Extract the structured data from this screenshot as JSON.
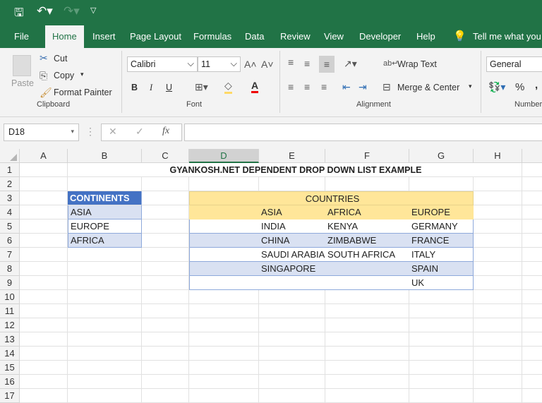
{
  "quick_access": {
    "save": "save-icon",
    "undo": "undo-icon",
    "redo": "redo-icon",
    "customize": "customize-icon"
  },
  "tabs": [
    "File",
    "Home",
    "Insert",
    "Page Layout",
    "Formulas",
    "Data",
    "Review",
    "View",
    "Developer",
    "Help"
  ],
  "tell_me": "Tell me what you",
  "clipboard": {
    "paste": "Paste",
    "cut": "Cut",
    "copy": "Copy",
    "format_painter": "Format Painter",
    "label": "Clipboard"
  },
  "font": {
    "name": "Calibri",
    "size": "11",
    "bold": "B",
    "italic": "I",
    "underline": "U",
    "label": "Font"
  },
  "alignment": {
    "wrap": "Wrap Text",
    "merge": "Merge & Center",
    "label": "Alignment"
  },
  "number": {
    "format": "General",
    "percent": "%",
    "comma": ",",
    "label": "Number"
  },
  "formula_bar": {
    "name_box": "D18",
    "fx": "fx",
    "value": ""
  },
  "columns": [
    "A",
    "B",
    "C",
    "D",
    "E",
    "F",
    "G",
    "H"
  ],
  "rows": [
    "1",
    "2",
    "3",
    "4",
    "5",
    "6",
    "7",
    "8",
    "9",
    "10",
    "11",
    "12",
    "13",
    "14",
    "15",
    "16",
    "17"
  ],
  "sheet": {
    "title": "GYANKOSH.NET DEPENDENT DROP DOWN LIST EXAMPLE",
    "continents_header": "CONTINENTS",
    "continents": [
      "ASIA",
      "EUROPE",
      "AFRICA"
    ],
    "countries_header": "COUNTRIES",
    "country_cols": [
      "ASIA",
      "AFRICA",
      "EUROPE"
    ],
    "country_rows": [
      [
        "INDIA",
        "KENYA",
        "GERMANY"
      ],
      [
        "CHINA",
        "ZIMBABWE",
        "FRANCE"
      ],
      [
        "SAUDI ARABIA",
        "SOUTH AFRICA",
        "ITALY"
      ],
      [
        "SINGAPORE",
        "",
        "SPAIN"
      ],
      [
        "",
        "",
        "UK"
      ]
    ]
  },
  "colors": {
    "green": "#217346",
    "blue_header": "#4472C4",
    "band": "#D9E1F2",
    "yellow": "#FFE699"
  }
}
